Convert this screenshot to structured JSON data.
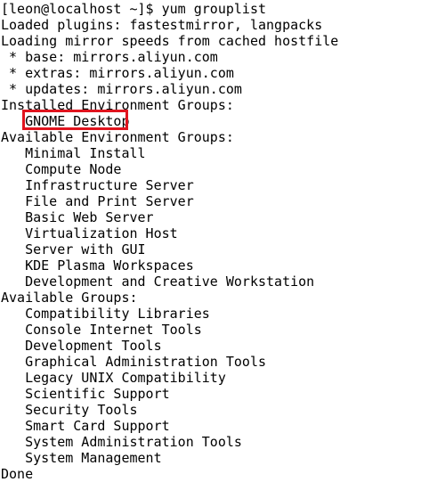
{
  "terminal": {
    "lines": [
      "[leon@localhost ~]$ yum grouplist",
      "Loaded plugins: fastestmirror, langpacks",
      "Loading mirror speeds from cached hostfile",
      " * base: mirrors.aliyun.com",
      " * extras: mirrors.aliyun.com",
      " * updates: mirrors.aliyun.com",
      "Installed Environment Groups:",
      "   GNOME Desktop",
      "Available Environment Groups:",
      "   Minimal Install",
      "   Compute Node",
      "   Infrastructure Server",
      "   File and Print Server",
      "   Basic Web Server",
      "   Virtualization Host",
      "   Server with GUI",
      "   KDE Plasma Workspaces",
      "   Development and Creative Workstation",
      "Available Groups:",
      "   Compatibility Libraries",
      "   Console Internet Tools",
      "   Development Tools",
      "   Graphical Administration Tools",
      "   Legacy UNIX Compatibility",
      "   Scientific Support",
      "   Security Tools",
      "   Smart Card Support",
      "   System Administration Tools",
      "   System Management",
      "Done"
    ],
    "highlighted_line": 7,
    "colors": {
      "background": "#ffffff",
      "text": "#000000",
      "highlight_border": "#e0141e"
    }
  }
}
